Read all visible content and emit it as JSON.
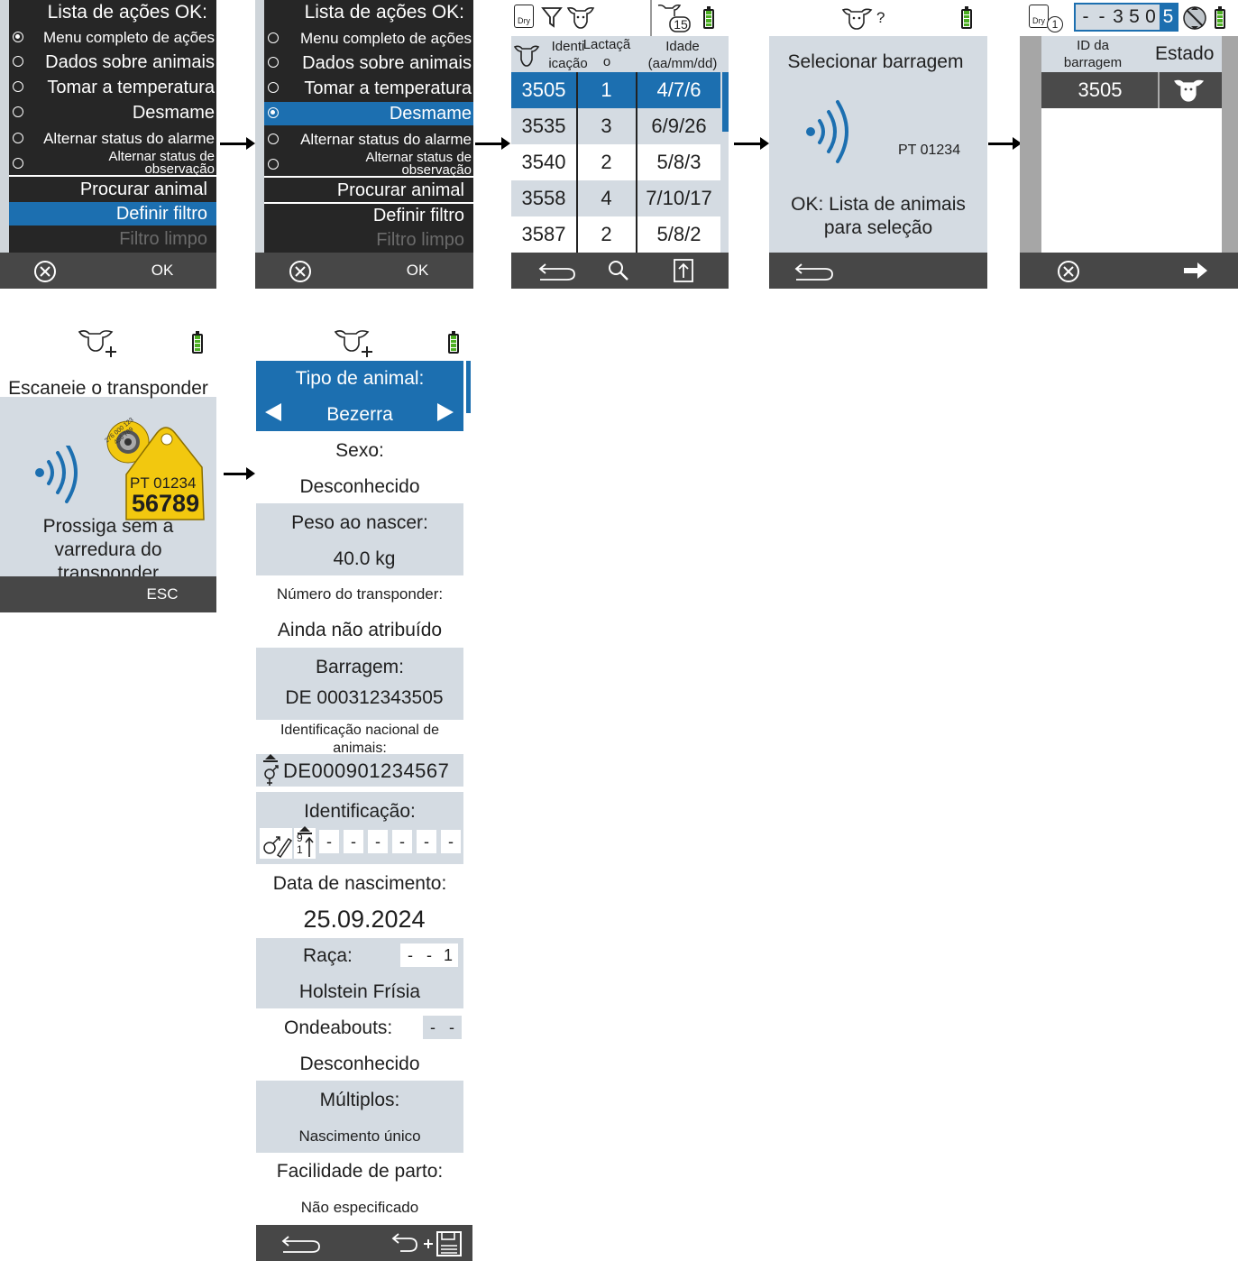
{
  "screen1": {
    "title": "Lista de ações OK:",
    "items": [
      {
        "label": "Menu completo de ações",
        "selected": true
      },
      {
        "label": "Dados sobre animais",
        "selected": false
      },
      {
        "label": "Tomar a temperatura",
        "selected": false
      },
      {
        "label": "Desmame",
        "selected": false
      },
      {
        "label": "Alternar status do alarme",
        "selected": false
      },
      {
        "label_line1": "Alternar status de",
        "label_line2": "observação",
        "selected": false
      }
    ],
    "search": "Procurar animal",
    "filter": "Definir filtro",
    "clear_filter": "Filtro limpo",
    "ok": "OK"
  },
  "screen2": {
    "title": "Lista de ações OK:",
    "items": [
      {
        "label": "Menu completo de ações"
      },
      {
        "label": "Dados sobre animais"
      },
      {
        "label": "Tomar a temperatura"
      },
      {
        "label": "Desmame",
        "selected": true
      },
      {
        "label": "Alternar status do alarme"
      },
      {
        "label_line1": "Alternar status de",
        "label_line2": "observação"
      }
    ],
    "search": "Procurar animal",
    "filter": "Definir filtro",
    "clear_filter": "Filtro limpo",
    "ok": "OK"
  },
  "screen3": {
    "dry_badge": "Dry",
    "count_badge": "15",
    "headers": {
      "id_1": "Identi",
      "id_2": "icação",
      "lact_1": "Lactaçã",
      "lact_2": "o",
      "age_1": "Idade",
      "age_2": "(aa/mm/dd)"
    },
    "rows": [
      {
        "id": "3505",
        "lact": "1",
        "age": "4/7/6"
      },
      {
        "id": "3535",
        "lact": "3",
        "age": "6/9/26"
      },
      {
        "id": "3540",
        "lact": "2",
        "age": "5/8/3"
      },
      {
        "id": "3558",
        "lact": "4",
        "age": "7/10/17"
      },
      {
        "id": "3587",
        "lact": "2",
        "age": "5/8/2"
      }
    ]
  },
  "screen4": {
    "header_q": "?",
    "title": "Selecionar barragem",
    "tag": "PT 01234",
    "hint_1": "OK: Lista de animais",
    "hint_2": "para seleção"
  },
  "screen5": {
    "dry_badge": "Dry",
    "dry_count": "1",
    "digits": [
      "-",
      "-",
      "3",
      "5",
      "0",
      "5"
    ],
    "col_id_1": "ID da",
    "col_id_2": "barragem",
    "col_state": "Estado",
    "row_id": "3505"
  },
  "screen6": {
    "title": "Escaneie o transponder",
    "tag_line1": "PT 01234",
    "tag_line2": "56789",
    "tag_ring": "276 000 123 456 789",
    "continue_1": "Prossiga sem a",
    "continue_2": "varredura do",
    "continue_3": "transponder",
    "esc": "ESC"
  },
  "screen7": {
    "animal_type_label": "Tipo de animal:",
    "animal_type_value": "Bezerra",
    "sex_label": "Sexo:",
    "sex_value": "Desconhecido",
    "birth_weight_label": "Peso ao nascer:",
    "birth_weight_value": "40.0 kg",
    "transponder_label": "Número do transponder:",
    "transponder_value": "Ainda não atribuído",
    "dam_label": "Barragem:",
    "dam_value": "DE 000312343505",
    "national_id_label_1": "Identificação nacional de",
    "national_id_label_2": "animais:",
    "national_id_value": "DE000901234567",
    "identification_label": "Identificação:",
    "identification_sort": "9 1",
    "identification_digits": [
      "-",
      "-",
      "-",
      "-",
      "-",
      "-"
    ],
    "birth_date_label": "Data de nascimento:",
    "birth_date_value": "25.09.2024",
    "breed_label": "Raça:",
    "breed_digits": [
      "-",
      "-",
      "1"
    ],
    "breed_value": "Holstein Frísia",
    "whereabouts_label": "Ondeabouts:",
    "whereabouts_digits": [
      "-",
      "-"
    ],
    "whereabouts_value": "Desconhecido",
    "multiples_label": "Múltiplos:",
    "multiples_value": "Nascimento único",
    "calving_label": "Facilidade de parto:",
    "calving_value": "Não especificado"
  },
  "colors": {
    "accent_blue": "#1c6fb0",
    "panel_gray": "#d4dbe2",
    "bar_gray": "#474747",
    "tag_yellow": "#f2c80f",
    "battery_green": "#4caf22"
  }
}
